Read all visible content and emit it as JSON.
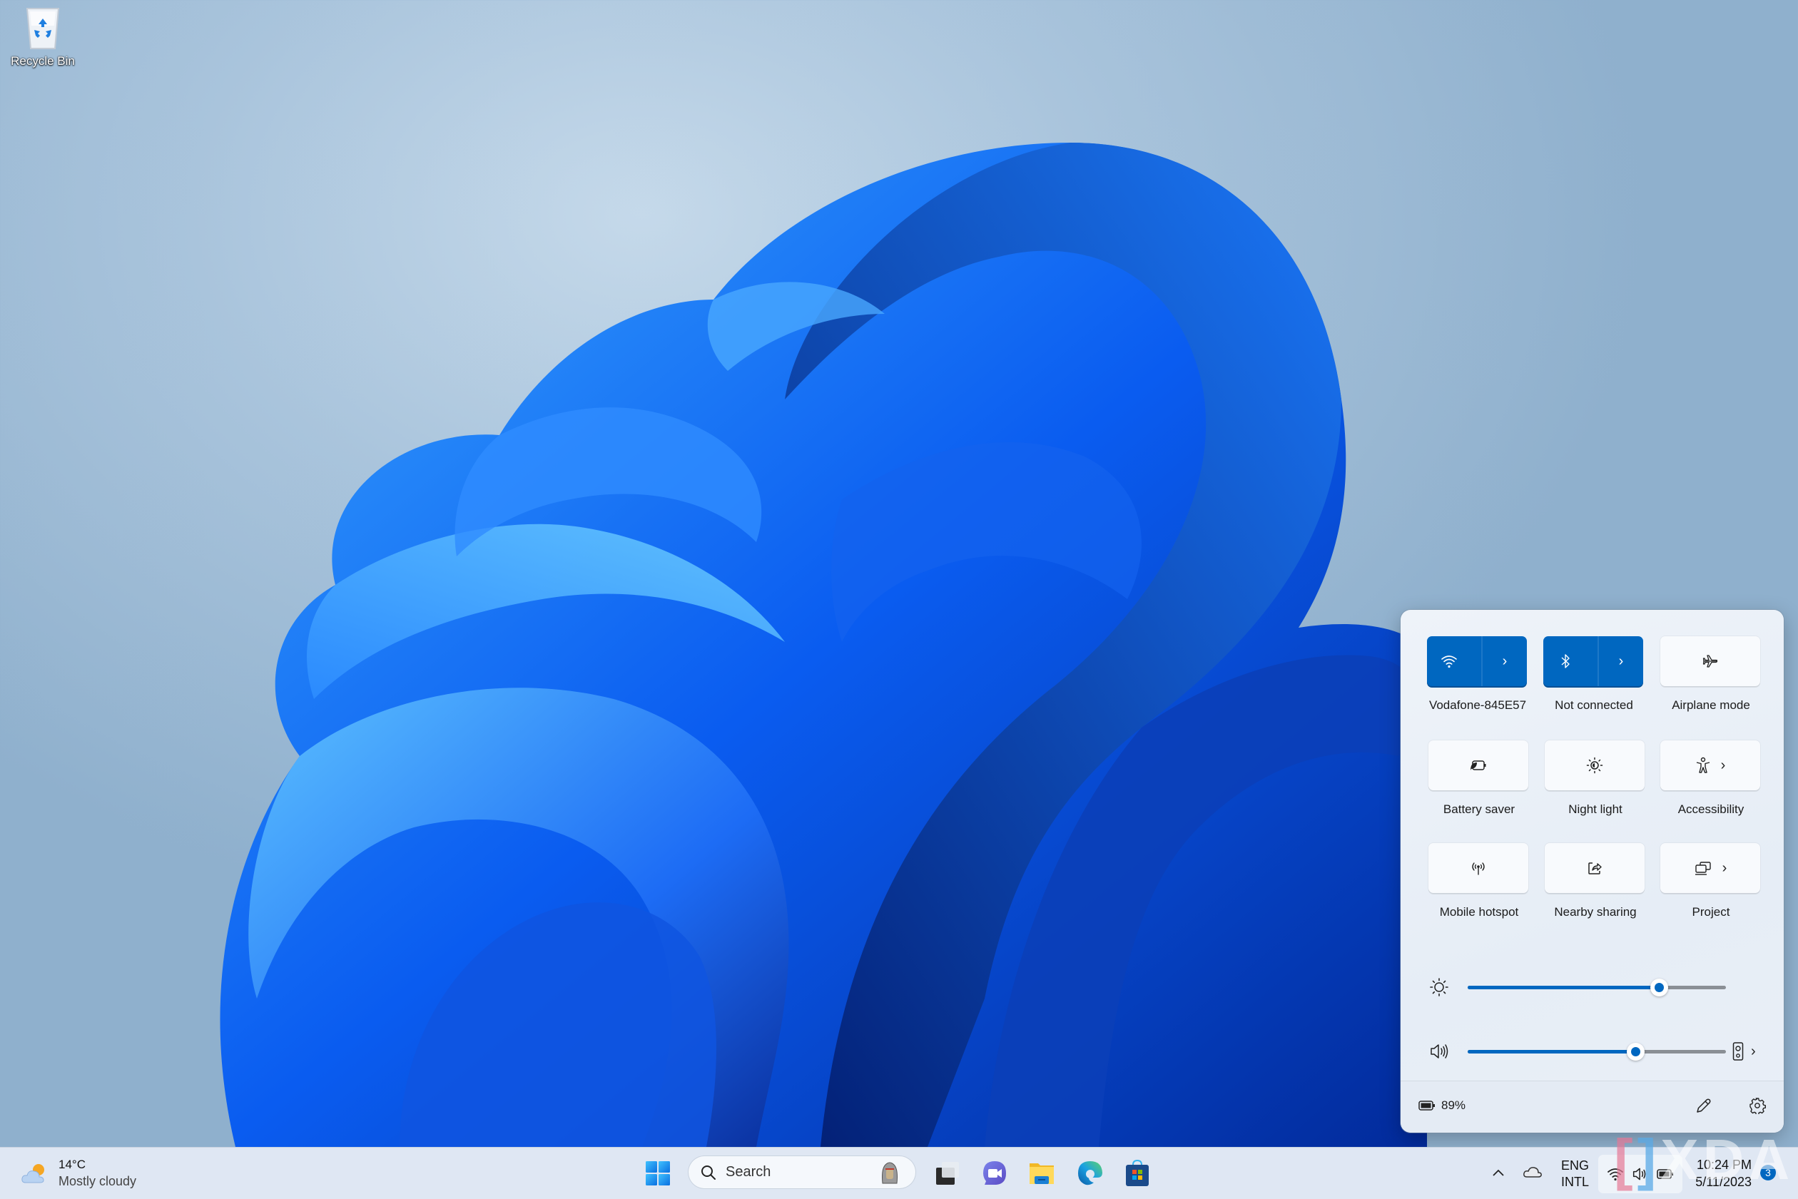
{
  "desktop": {
    "icons": [
      {
        "label": "Recycle Bin",
        "icon": "recycle-bin-icon"
      }
    ]
  },
  "quick_settings": {
    "accent": "#0067c0",
    "tiles": [
      {
        "label": "Vodafone-845E57",
        "icon": "wifi-icon",
        "active": true,
        "expandable": true
      },
      {
        "label": "Not connected",
        "icon": "bluetooth-icon",
        "active": true,
        "expandable": true
      },
      {
        "label": "Airplane mode",
        "icon": "airplane-icon",
        "active": false,
        "expandable": false
      },
      {
        "label": "Battery saver",
        "icon": "battery-saver-icon",
        "active": false,
        "expandable": false
      },
      {
        "label": "Night light",
        "icon": "night-light-icon",
        "active": false,
        "expandable": false
      },
      {
        "label": "Accessibility",
        "icon": "accessibility-icon",
        "active": false,
        "expandable": true
      },
      {
        "label": "Mobile hotspot",
        "icon": "hotspot-icon",
        "active": false,
        "expandable": false
      },
      {
        "label": "Nearby sharing",
        "icon": "share-icon",
        "active": false,
        "expandable": false
      },
      {
        "label": "Project",
        "icon": "project-icon",
        "active": false,
        "expandable": true
      }
    ],
    "brightness": {
      "icon": "brightness-icon",
      "value_percent": 74
    },
    "volume": {
      "icon": "speaker-icon",
      "value_percent": 65,
      "output_icon": "audio-output-icon"
    },
    "battery": {
      "icon": "battery-icon",
      "percent_label": "89%"
    },
    "footer_buttons": [
      {
        "name": "edit",
        "icon": "pencil-icon"
      },
      {
        "name": "settings",
        "icon": "gear-icon"
      }
    ]
  },
  "taskbar": {
    "weather": {
      "temp": "14°C",
      "condition": "Mostly cloudy",
      "icon": "partly-cloudy-icon"
    },
    "search": {
      "placeholder": "Search"
    },
    "apps": [
      {
        "name": "start",
        "icon": "windows-logo-icon"
      },
      {
        "name": "task-view",
        "icon": "task-view-icon"
      },
      {
        "name": "teams-chat",
        "icon": "teams-chat-icon"
      },
      {
        "name": "file-explorer",
        "icon": "folder-icon"
      },
      {
        "name": "edge",
        "icon": "edge-icon"
      },
      {
        "name": "microsoft-store",
        "icon": "store-icon"
      }
    ],
    "tray": {
      "language_line1": "ENG",
      "language_line2": "INTL",
      "time": "10:24 PM",
      "date": "5/11/2023",
      "notification_count": "3"
    }
  },
  "watermark": {
    "text": "XDA"
  }
}
